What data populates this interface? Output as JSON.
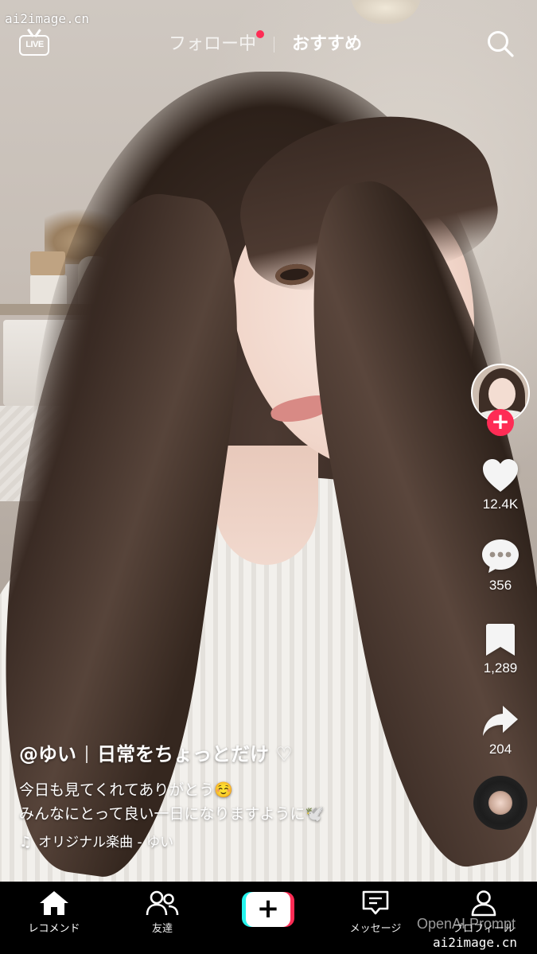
{
  "watermark": {
    "top": "ai2image.cn",
    "bottom": "ai2image.cn",
    "openai": "OpenAI Prompt"
  },
  "top_bar": {
    "live_label": "LIVE",
    "tab_following": "フォロー中",
    "tab_recommend": "おすすめ",
    "active_tab": "おすすめ",
    "following_has_new": true
  },
  "actions": {
    "like_count": "12.4K",
    "comment_count": "356",
    "bookmark_count": "1,289",
    "share_count": "204",
    "follow_plus": "+"
  },
  "caption": {
    "username": "@ゆい",
    "headline": "日常をちょっとだけ ♡",
    "line1": "今日も見てくれてありがとう☺️",
    "line2": "みんなにとって良い一日になりますように🕊️",
    "music_note": "♫",
    "music": "オリジナル楽曲 - ゆい"
  },
  "bottom_nav": {
    "home": "レコメンド",
    "friends": "友達",
    "create": "+",
    "inbox": "メッセージ",
    "profile": "プロフィール"
  },
  "colors": {
    "accent_red": "#fe2c55",
    "accent_cyan": "#25f4ee",
    "nav_background": "#000000"
  },
  "icons": [
    "live-icon",
    "search-icon",
    "heart-icon",
    "comment-icon",
    "bookmark-icon",
    "share-icon",
    "music-disc-icon",
    "home-icon",
    "friends-icon",
    "create-icon",
    "inbox-icon",
    "profile-icon"
  ]
}
